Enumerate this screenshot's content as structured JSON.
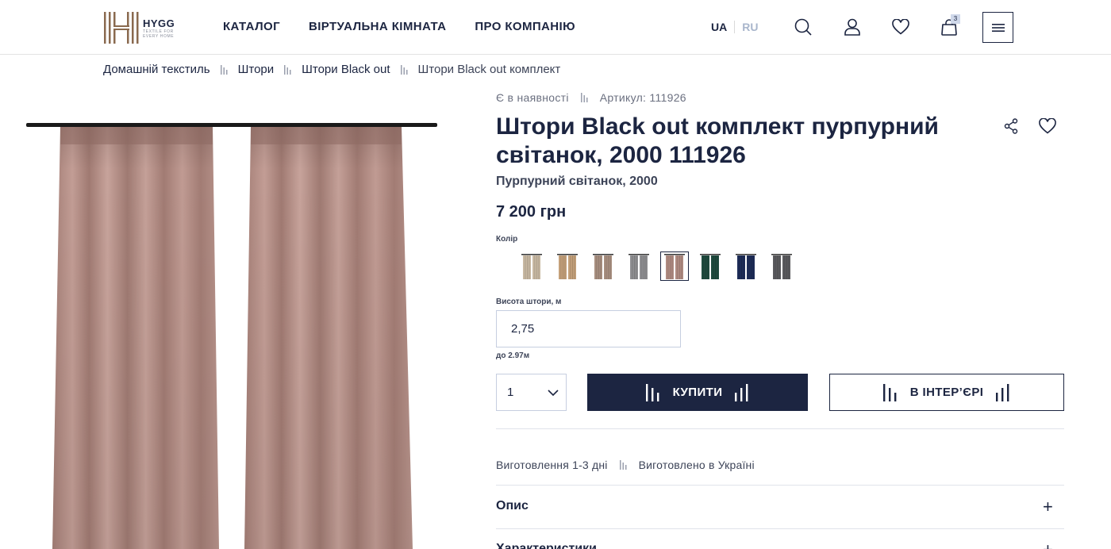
{
  "brand": {
    "name": "HYGG",
    "tagline": "TEXTILE FOR EVERY HOME"
  },
  "nav": [
    {
      "label": "КАТАЛОГ"
    },
    {
      "label": "ВІРТУАЛЬНА КІМНАТА"
    },
    {
      "label": "ПРО КОМПАНІЮ"
    }
  ],
  "lang": {
    "active": "UA",
    "inactive": "RU"
  },
  "header_icons": {
    "search": "search-icon",
    "account": "user-icon",
    "wishlist": "heart-icon",
    "cart": "shopping-bag-icon",
    "cart_count": "3",
    "menu": "hamburger-icon"
  },
  "breadcrumb": [
    {
      "label": "Домашній текстиль"
    },
    {
      "label": "Штори"
    },
    {
      "label": "Штори Black out"
    },
    {
      "label": "Штори Black out комплект"
    }
  ],
  "product": {
    "availability": "Є в наявності",
    "sku": "Артикул: 111926",
    "title": "Штори Black out комплект пурпурний світанок, 2000 111926",
    "subtitle": "Пурпурний світанок, 2000",
    "price": "7 200 грн",
    "color_label": "Колір",
    "colors": [
      {
        "name": "light-beige",
        "hex": "#c9b9a3"
      },
      {
        "name": "sand",
        "hex": "#c4a07a"
      },
      {
        "name": "taupe",
        "hex": "#a88f80"
      },
      {
        "name": "grey",
        "hex": "#8f8f92"
      },
      {
        "name": "purple-dawn",
        "hex": "#b08b82",
        "selected": true
      },
      {
        "name": "emerald",
        "hex": "#1f4a3e"
      },
      {
        "name": "navy",
        "hex": "#1e2d58"
      },
      {
        "name": "graphite",
        "hex": "#5b5b5e"
      }
    ],
    "curtain_color": "#b39089",
    "height_label": "Висота штори, м",
    "height_value": "2,75",
    "height_hint": "до 2.97м",
    "quantity": "1",
    "buy_label": "КУПИТИ",
    "interior_label": "В ІНТЕР’ЄРІ",
    "features": [
      "Виготовлення 1-3 дні",
      "Виготовлено в Україні"
    ],
    "accordion": [
      {
        "label": "Опис"
      },
      {
        "label": "Характеристики"
      }
    ]
  },
  "colors": {
    "primary": "#1c2541",
    "muted_text": "#6b7080",
    "border": "#c6cee0"
  }
}
